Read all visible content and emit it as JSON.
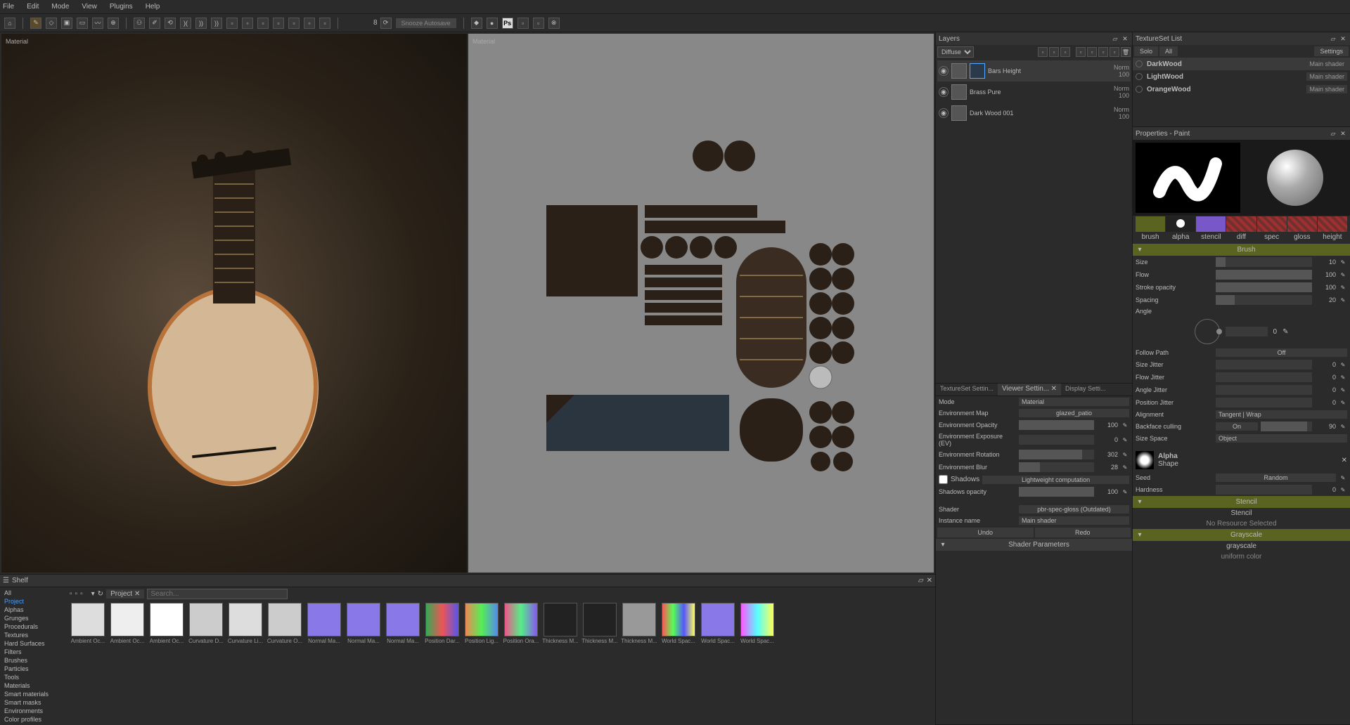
{
  "menu": [
    "File",
    "Edit",
    "Mode",
    "View",
    "Plugins",
    "Help"
  ],
  "toolbar": {
    "spin": "8",
    "autosave": "Snooze Autosave"
  },
  "viewport": {
    "left_label": "Material",
    "right_label": "Material"
  },
  "layers": {
    "title": "Layers",
    "mode": "Diffuse",
    "items": [
      {
        "name": "Bars Height",
        "blend": "Norm",
        "opacity": "100",
        "sel": true
      },
      {
        "name": "Brass Pure",
        "blend": "Norm",
        "opacity": "100"
      },
      {
        "name": "Dark Wood 001",
        "blend": "Norm",
        "opacity": "100"
      }
    ]
  },
  "viewer_tabs": [
    "TextureSet Settin...",
    "Viewer Settin...",
    "Display Setti..."
  ],
  "viewer": {
    "mode_label": "Mode",
    "mode": "Material",
    "env_label": "Environment Map",
    "env": "glazed_patio",
    "rows": [
      {
        "l": "Environment Opacity",
        "v": "100"
      },
      {
        "l": "Environment Exposure (EV)",
        "v": "0"
      },
      {
        "l": "Environment Rotation",
        "v": "302"
      },
      {
        "l": "Environment Blur",
        "v": "28"
      }
    ],
    "shadows_label": "Shadows",
    "shadows_mode": "Lightweight computation",
    "shadows_opacity_l": "Shadows opacity",
    "shadows_opacity": "100",
    "shader_l": "Shader",
    "shader": "pbr-spec-gloss (Outdated)",
    "instance_l": "Instance name",
    "instance": "Main shader",
    "undo": "Undo",
    "redo": "Redo",
    "params_head": "Shader Parameters"
  },
  "tset": {
    "title": "TextureSet List",
    "solo": "Solo",
    "all": "All",
    "settings": "Settings",
    "items": [
      {
        "name": "DarkWood",
        "shader": "Main shader",
        "sel": true
      },
      {
        "name": "LightWood",
        "shader": "Main shader"
      },
      {
        "name": "OrangeWood",
        "shader": "Main shader"
      }
    ]
  },
  "props": {
    "title": "Properties - Paint",
    "channels": [
      "brush",
      "alpha",
      "stencil",
      "diff",
      "spec",
      "gloss",
      "height"
    ],
    "brush_head": "Brush",
    "sliders": [
      {
        "l": "Size",
        "v": "10"
      },
      {
        "l": "Flow",
        "v": "100"
      },
      {
        "l": "Stroke opacity",
        "v": "100"
      },
      {
        "l": "Spacing",
        "v": "20"
      }
    ],
    "angle_l": "Angle",
    "angle": "0",
    "follow_l": "Follow Path",
    "follow": "Off",
    "jitters": [
      {
        "l": "Size Jitter",
        "v": "0"
      },
      {
        "l": "Flow Jitter",
        "v": "0"
      },
      {
        "l": "Angle Jitter",
        "v": "0"
      },
      {
        "l": "Position Jitter",
        "v": "0"
      }
    ],
    "alignment_l": "Alignment",
    "alignment": "Tangent | Wrap",
    "backface_l": "Backface culling",
    "backface_on": "On",
    "backface_v": "90",
    "sizespace_l": "Size Space",
    "sizespace": "Object",
    "alpha_head": "Alpha",
    "alpha_shape": "Shape",
    "seed_l": "Seed",
    "seed_btn": "Random",
    "hardness_l": "Hardness",
    "hardness": "0",
    "stencil_head": "Stencil",
    "stencil_txt": "Stencil",
    "stencil_none": "No Resource Selected",
    "gray_head": "Grayscale",
    "gray_txt": "grayscale",
    "gray_mode": "uniform color"
  },
  "shelf": {
    "title": "Shelf",
    "tab": "Project",
    "search_ph": "Search...",
    "cats": [
      "All",
      "Project",
      "Alphas",
      "Grunges",
      "Procedurals",
      "Textures",
      "Hard Surfaces",
      "Filters",
      "Brushes",
      "Particles",
      "Tools",
      "Materials",
      "Smart materials",
      "Smart masks",
      "Environments",
      "Color profiles"
    ],
    "active_cat": "Project",
    "thumbs": [
      "Ambient Oc...",
      "Ambient Oc...",
      "Ambient Oc...",
      "Curvature D...",
      "Curvature Li...",
      "Curvature O...",
      "Normal Ma...",
      "Normal Ma...",
      "Normal Ma...",
      "Position Dar...",
      "Position Lig...",
      "Position Ora...",
      "Thickness M...",
      "Thickness M...",
      "Thickness M...",
      "World Spac...",
      "World Spac...",
      "World Spac..."
    ]
  }
}
